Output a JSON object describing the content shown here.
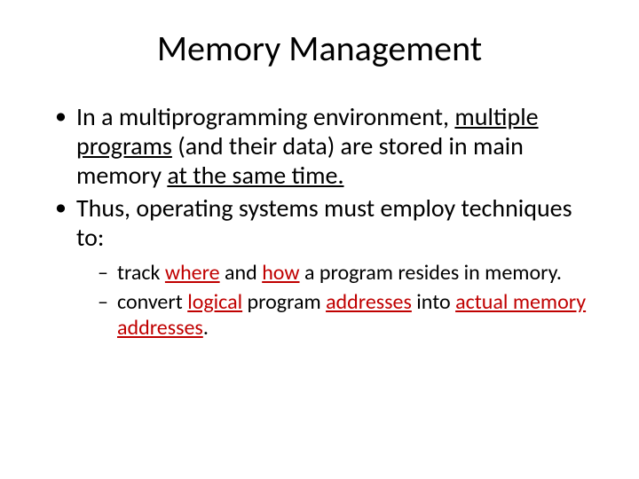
{
  "title": "Memory Management",
  "b1": {
    "p1": "In a multiprogramming environment, ",
    "p2": "multiple programs",
    "p3": " (and their data) are stored in main memory ",
    "p4": "at the same time.",
    "p5": ""
  },
  "b2": "Thus, operating systems must employ techniques to:",
  "s1": {
    "p1": "track ",
    "p2": "where",
    "p3": " and ",
    "p4": "how",
    "p5": " a program resides in memory."
  },
  "s2": {
    "p1": "convert ",
    "p2": "logical",
    "p3": " program ",
    "p4": "addresses",
    "p5": " into ",
    "p6": "actual memory addresses",
    "p7": "."
  }
}
